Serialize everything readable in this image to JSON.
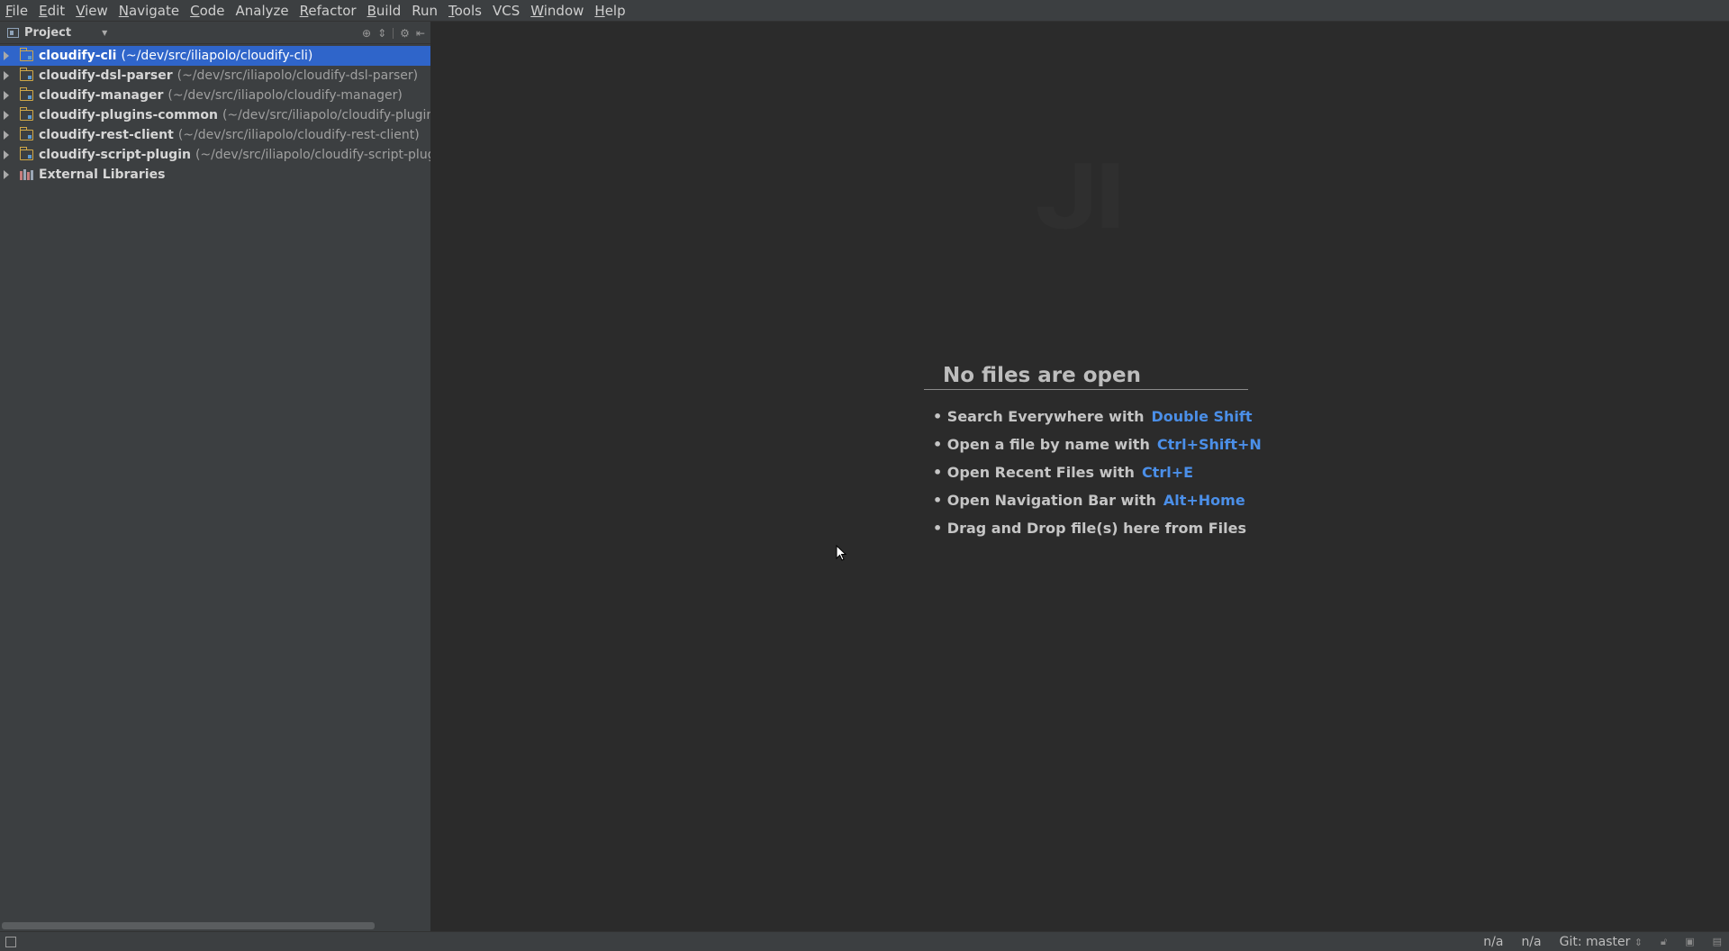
{
  "menu": [
    {
      "label": "File",
      "ul": "F",
      "rest": "ile"
    },
    {
      "label": "Edit",
      "ul": "E",
      "rest": "dit"
    },
    {
      "label": "View",
      "ul": "V",
      "rest": "iew"
    },
    {
      "label": "Navigate",
      "ul": "N",
      "rest": "avigate"
    },
    {
      "label": "Code",
      "ul": "C",
      "rest": "ode"
    },
    {
      "label": "Analyze",
      "ul": "",
      "rest": "Analyze"
    },
    {
      "label": "Refactor",
      "ul": "R",
      "rest": "efactor"
    },
    {
      "label": "Build",
      "ul": "B",
      "rest": "uild"
    },
    {
      "label": "Run",
      "ul": "",
      "rest": "Run"
    },
    {
      "label": "Tools",
      "ul": "T",
      "rest": "ools"
    },
    {
      "label": "VCS",
      "ul": "",
      "rest": "VCS"
    },
    {
      "label": "Window",
      "ul": "W",
      "rest": "indow"
    },
    {
      "label": "Help",
      "ul": "H",
      "rest": "elp"
    }
  ],
  "project_panel": {
    "title": "Project",
    "items": [
      {
        "name": "cloudify-cli",
        "path": "(~/dev/src/iliapolo/cloudify-cli)"
      },
      {
        "name": "cloudify-dsl-parser",
        "path": "(~/dev/src/iliapolo/cloudify-dsl-parser)"
      },
      {
        "name": "cloudify-manager",
        "path": "(~/dev/src/iliapolo/cloudify-manager)"
      },
      {
        "name": "cloudify-plugins-common",
        "path": "(~/dev/src/iliapolo/cloudify-plugins-"
      },
      {
        "name": "cloudify-rest-client",
        "path": "(~/dev/src/iliapolo/cloudify-rest-client)"
      },
      {
        "name": "cloudify-script-plugin",
        "path": "(~/dev/src/iliapolo/cloudify-script-plug"
      }
    ],
    "external": "External Libraries"
  },
  "editor": {
    "title": "No files are open",
    "hints": [
      {
        "text": "• Search Everywhere with",
        "key": "Double Shift"
      },
      {
        "text": "• Open a file by name with",
        "key": "Ctrl+Shift+N"
      },
      {
        "text": "• Open Recent Files with",
        "key": "Ctrl+E"
      },
      {
        "text": "• Open Navigation Bar with",
        "key": "Alt+Home"
      },
      {
        "text": "• Drag and Drop file(s) here from Files",
        "key": ""
      }
    ]
  },
  "status": {
    "pos1": "n/a",
    "pos2": "n/a",
    "git": "Git: master"
  },
  "colors": {
    "accent": "#2f65ca",
    "key": "#4b8fe8"
  }
}
